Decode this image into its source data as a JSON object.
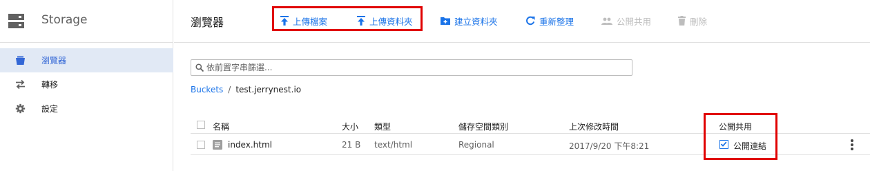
{
  "app": {
    "product_name": "Storage"
  },
  "sidebar": {
    "items": [
      {
        "label": "瀏覽器",
        "icon": "bucket-icon",
        "active": true
      },
      {
        "label": "轉移",
        "icon": "transfer-icon",
        "active": false
      },
      {
        "label": "設定",
        "icon": "gear-icon",
        "active": false
      }
    ]
  },
  "toolbar": {
    "title": "瀏覽器",
    "upload_files": "上傳檔案",
    "upload_folder": "上傳資料夾",
    "create_folder": "建立資料夾",
    "refresh": "重新整理",
    "share_publicly": "公開共用",
    "delete": "刪除"
  },
  "filter": {
    "placeholder": "依前置字串篩選..."
  },
  "breadcrumb": {
    "root": "Buckets",
    "separator": "/",
    "current": "test.jerrynest.io"
  },
  "table": {
    "columns": {
      "name": "名稱",
      "size": "大小",
      "type": "類型",
      "storage_class": "儲存空間類別",
      "modified": "上次修改時間",
      "public": "公開共用"
    },
    "rows": [
      {
        "name": "index.html",
        "size": "21 B",
        "type": "text/html",
        "storage_class": "Regional",
        "modified": "2017/9/20 下午8:21",
        "public_link": "公開連結",
        "public_checked": true
      }
    ]
  },
  "colors": {
    "accent": "#1a73e8",
    "highlight": "#e00000",
    "active_nav_bg": "#e1e9f5"
  }
}
